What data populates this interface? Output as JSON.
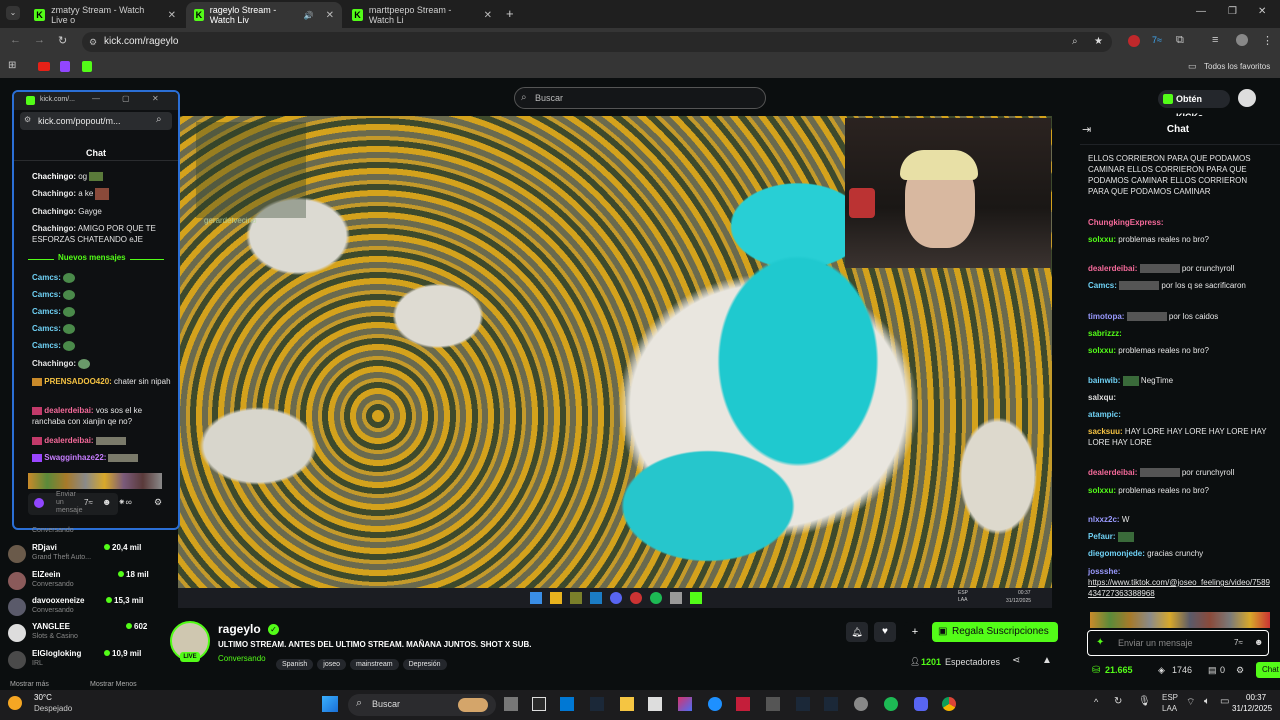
{
  "browser": {
    "tabs": [
      {
        "label": "zmatyy Stream - Watch Live o"
      },
      {
        "label": "rageylo Stream - Watch Liv"
      },
      {
        "label": "marttpeepo Stream - Watch Li"
      }
    ],
    "url": "kick.com/rageylo",
    "favorites_label": "Todos los favoritos"
  },
  "kick": {
    "search_placeholder": "Buscar",
    "get_kicks_label": "Obtén KICKs"
  },
  "popout": {
    "url": "kick.com/popout/m...",
    "favicon_text": "kick.com/...",
    "chat_title": "Chat",
    "new_messages_label": "Nuevos mensajes",
    "messages": [
      {
        "user": "Chachingo:",
        "text": "og"
      },
      {
        "user": "Chachingo:",
        "text": "a ke"
      },
      {
        "user": "Chachingo:",
        "text": "Gayge"
      },
      {
        "user": "Chachingo:",
        "text": "AMIGO POR QUE TE ESFORZAS CHATEANDO eJE"
      }
    ],
    "messages_after": [
      {
        "user": "Camcs:",
        "text": ""
      },
      {
        "user": "Camcs:",
        "text": ""
      },
      {
        "user": "Camcs:",
        "text": ""
      },
      {
        "user": "Camcs:",
        "text": ""
      },
      {
        "user": "Camcs:",
        "text": ""
      },
      {
        "user": "Chachingo:",
        "text": ""
      },
      {
        "user": "PRENSADOO420:",
        "text": "chater sin nipah"
      },
      {
        "user": "dealerdeibai:",
        "text": "vos sos el ke ranchaba con xianjin qe no?"
      },
      {
        "user": "dealerdeibai:",
        "text": ""
      },
      {
        "user": "Swagginhaze22:",
        "text": ""
      }
    ],
    "input_placeholder": "Enviar un mensaje"
  },
  "video": {
    "overlay_names": [
      "gerardelvecino"
    ],
    "tray_lang": "ESP LAA",
    "tray_time": "00:37",
    "tray_date": "31/12/2025"
  },
  "stream": {
    "channel_name": "rageylo",
    "title": "ULTIMO STREAM. ANTES DEL ULTIMO STREAM. MAÑANA JUNTOS. SHOT X SUB.",
    "category": "Conversando",
    "tags": [
      "Spanish",
      "joseo",
      "mainstream",
      "Depresión"
    ],
    "live_badge": "LIVE",
    "subscribe_label": "Regala Suscripciones",
    "viewers_count": "1201",
    "viewers_label": "Espectadores"
  },
  "left_channels": {
    "items": [
      {
        "name": "RDjavi",
        "category": "Grand Theft Auto...",
        "viewers": "20,4 mil"
      },
      {
        "name": "ElZeein",
        "category": "Conversando",
        "viewers": "18 mil"
      },
      {
        "name": "davooxeneize",
        "category": "Conversando",
        "viewers": "15,3 mil"
      },
      {
        "name": "YANGLEE",
        "category": "Slots & Casino",
        "viewers": "602"
      },
      {
        "name": "ElGlogloking",
        "category": "IRL",
        "viewers": "10,9 mil"
      }
    ],
    "show_more": "Mostrar más",
    "show_less": "Mostrar Menos",
    "conversando_top": "Conversando"
  },
  "chat": {
    "title": "Chat",
    "messages": [
      {
        "user": "",
        "text": "ELLOS CORRIERON PARA QUE PODAMOS CAMINAR ELLOS CORRIERON PARA QUE PODAMOS CAMINAR ELLOS CORRIERON PARA QUE PODAMOS CAMINAR"
      },
      {
        "user": "ChungkingExpress:",
        "text": ""
      },
      {
        "user": "solxxu:",
        "text": "problemas reales no bro?"
      },
      {
        "user": "dealerdeibai:",
        "text": "por crunchyroll"
      },
      {
        "user": "Camcs:",
        "text": "por los q se sacrificaron"
      },
      {
        "user": "timotopa:",
        "text": "por los caidos"
      },
      {
        "user": "sabrizzz:",
        "text": ""
      },
      {
        "user": "solxxu:",
        "text": "problemas reales no bro?"
      },
      {
        "user": "bainwib:",
        "text": "NegTime"
      },
      {
        "user": "salxqu:",
        "text": ""
      },
      {
        "user": "atampic:",
        "text": ""
      },
      {
        "user": "sacksuu:",
        "text": "HAY LORE HAY LORE HAY LORE HAY LORE HAY LORE"
      },
      {
        "user": "dealerdeibai:",
        "text": "por crunchyroll"
      },
      {
        "user": "solxxu:",
        "text": "problemas reales no bro?"
      },
      {
        "user": "nlxxz2c:",
        "text": "W"
      },
      {
        "user": "Pefaur:",
        "text": ""
      },
      {
        "user": "diegomonjede:",
        "text": "gracias crunchy"
      },
      {
        "user": "jossshe:",
        "text": "https://www.tiktok.com/@joseo_feelings/video/7589434727363388968"
      }
    ],
    "input_placeholder": "Enviar un mensaje",
    "kicks_balance": "21.665",
    "second_balance": "1746",
    "third_balance": "0",
    "chat_button": "Chat"
  },
  "taskbar": {
    "weather_temp": "30°C",
    "weather_desc": "Despejado",
    "search_label": "Buscar",
    "lang": "ESP",
    "lang2": "LAA",
    "time": "00:37",
    "date": "31/12/2025"
  },
  "colors": {
    "kick_green": "#53fc18",
    "popout_border": "#2b6fd6",
    "page_bg": "#0b0e0f"
  }
}
